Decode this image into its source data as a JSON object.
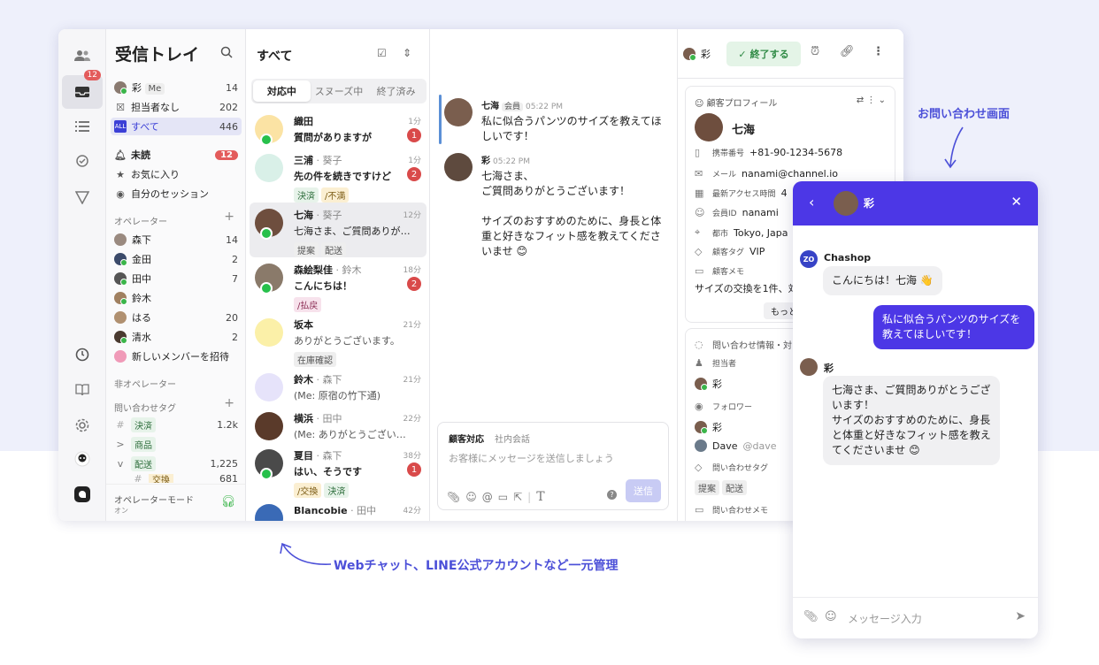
{
  "callouts": {
    "widget": "お問い合わせ画面",
    "bottom": "Webチャット、LINE公式アカウントなど一元管理"
  },
  "rail": {
    "badge": "12"
  },
  "inbox": {
    "title": "受信トレイ",
    "rows": [
      {
        "label": "彩",
        "me": "Me",
        "count": "14"
      },
      {
        "label": "担当者なし",
        "count": "202"
      },
      {
        "label": "すべて",
        "count": "446"
      },
      {
        "label": "未読",
        "count": "12"
      },
      {
        "label": "お気に入り",
        "count": ""
      },
      {
        "label": "自分のセッション",
        "count": ""
      }
    ],
    "operators_header": "オペレーター",
    "operators": [
      {
        "name": "森下",
        "count": "14"
      },
      {
        "name": "金田",
        "count": "2"
      },
      {
        "name": "田中",
        "count": "7"
      },
      {
        "name": "鈴木",
        "count": ""
      },
      {
        "name": "はる",
        "count": "20"
      },
      {
        "name": "清水",
        "count": "2"
      }
    ],
    "invite": "新しいメンバーを招待",
    "non_operator": "非オペレーター",
    "tags_header": "問い合わせタグ",
    "tags": [
      {
        "prefix": "#",
        "name": "決済",
        "count": "1.2k"
      },
      {
        "prefix": ">",
        "name": "商品",
        "count": ""
      },
      {
        "prefix": "v",
        "name": "配送",
        "count": "1,225"
      },
      {
        "prefix": "#",
        "name": "交換",
        "count": "681"
      }
    ],
    "mode_label": "オペレーターモード",
    "mode_value": "オン"
  },
  "convlist": {
    "title": "すべて",
    "tabs": [
      "対応中",
      "スヌーズ中",
      "終了済み"
    ],
    "items": [
      {
        "name": "織田",
        "assignee": "",
        "time": "1分",
        "msg": "質問がありますが",
        "bold": true,
        "count": "1",
        "tags": []
      },
      {
        "name": "三浦",
        "assignee": "葵子",
        "time": "1分",
        "msg": "先の件を続きですけど",
        "bold": true,
        "count": "2",
        "tags": [
          "決済",
          "/不満"
        ]
      },
      {
        "name": "七海",
        "assignee": "葵子",
        "time": "12分",
        "msg": "七海さま、ご質問ありがとうござい...",
        "bold": false,
        "count": "",
        "tags": [
          "提案",
          "配送"
        ]
      },
      {
        "name": "森絵梨佳",
        "assignee": "鈴木",
        "time": "18分",
        "msg": "こんにちは！",
        "bold": true,
        "count": "2",
        "tags": [
          "/払戻"
        ]
      },
      {
        "name": "坂本",
        "assignee": "",
        "time": "21分",
        "msg": "ありがとうございます。",
        "bold": false,
        "count": "",
        "tags": [
          "在庫確認"
        ]
      },
      {
        "name": "鈴木",
        "assignee": "森下",
        "time": "21分",
        "msg": "(Me: 原宿の竹下通)",
        "bold": false,
        "count": "",
        "tags": []
      },
      {
        "name": "横浜",
        "assignee": "田中",
        "time": "22分",
        "msg": "(Me: ありがとうございます！)",
        "bold": false,
        "count": "",
        "tags": []
      },
      {
        "name": "夏目",
        "assignee": "森下",
        "time": "38分",
        "msg": "はい、そうです",
        "bold": true,
        "count": "1",
        "tags": [
          "/交換",
          "決済"
        ]
      },
      {
        "name": "Blancobie",
        "assignee": "田中",
        "time": "42分",
        "msg": "",
        "bold": false,
        "count": "",
        "tags": []
      }
    ]
  },
  "chat": {
    "name": "七海",
    "tags": [
      "提案",
      "配送"
    ],
    "agent": "彩",
    "done": "終了する",
    "messages": [
      {
        "name": "七海",
        "badge": "会員",
        "time": "05:22 PM",
        "text": "私に似合うパンツのサイズを教えてほしいです！"
      },
      {
        "name": "彩",
        "badge": "",
        "time": "05:22 PM",
        "text": "七海さま、\nご質問ありがとうございます！\n\nサイズのおすすめのために、身長と体重と好きなフィット感を教えてくださいませ 😊"
      }
    ],
    "composer": {
      "tab_on": "顧客対応",
      "tab_off": "社内会話",
      "placeholder": "お客様にメッセージを送信しましょう",
      "send": "送信"
    }
  },
  "profile": {
    "header": "顧客プロフィール",
    "name": "七海",
    "rows": [
      {
        "key": "携帯番号",
        "value": "+81-90-1234-5678"
      },
      {
        "key": "メール",
        "value": "nanami@channel.io"
      },
      {
        "key": "最新アクセス時間",
        "value": "4"
      },
      {
        "key": "会員ID",
        "value": "nanami"
      },
      {
        "key": "都市",
        "value": "Tokyo, Japa"
      },
      {
        "key": "顧客タグ",
        "value": "VIP"
      },
      {
        "key": "顧客メモ",
        "value": ""
      }
    ],
    "note": "サイズの交換を1件、対",
    "more": "もっと"
  },
  "info": {
    "header": "問い合わせ情報・対",
    "assignee_label": "担当者",
    "assignee": "彩",
    "follower_label": "フォロワー",
    "followers": [
      "彩",
      "Dave"
    ],
    "dave_handle": "@dave",
    "tag_label": "問い合わせタグ",
    "tags": [
      "提案",
      "配送"
    ],
    "memo_label": "問い合わせメモ"
  },
  "widget": {
    "agent": "彩",
    "bot_name": "Chashop",
    "bot_badge": "ZO",
    "bot_msg": "こんにちは！七海 👋",
    "user_msg": "私に似合うパンツのサイズを教えてほしいです！",
    "op_name": "彩",
    "op_msg": "七海さま、ご質問ありがとうございます！\nサイズのおすすめのために、身長と体重と好きなフィット感を教えてくださいませ 😊",
    "placeholder": "メッセージ入力"
  }
}
